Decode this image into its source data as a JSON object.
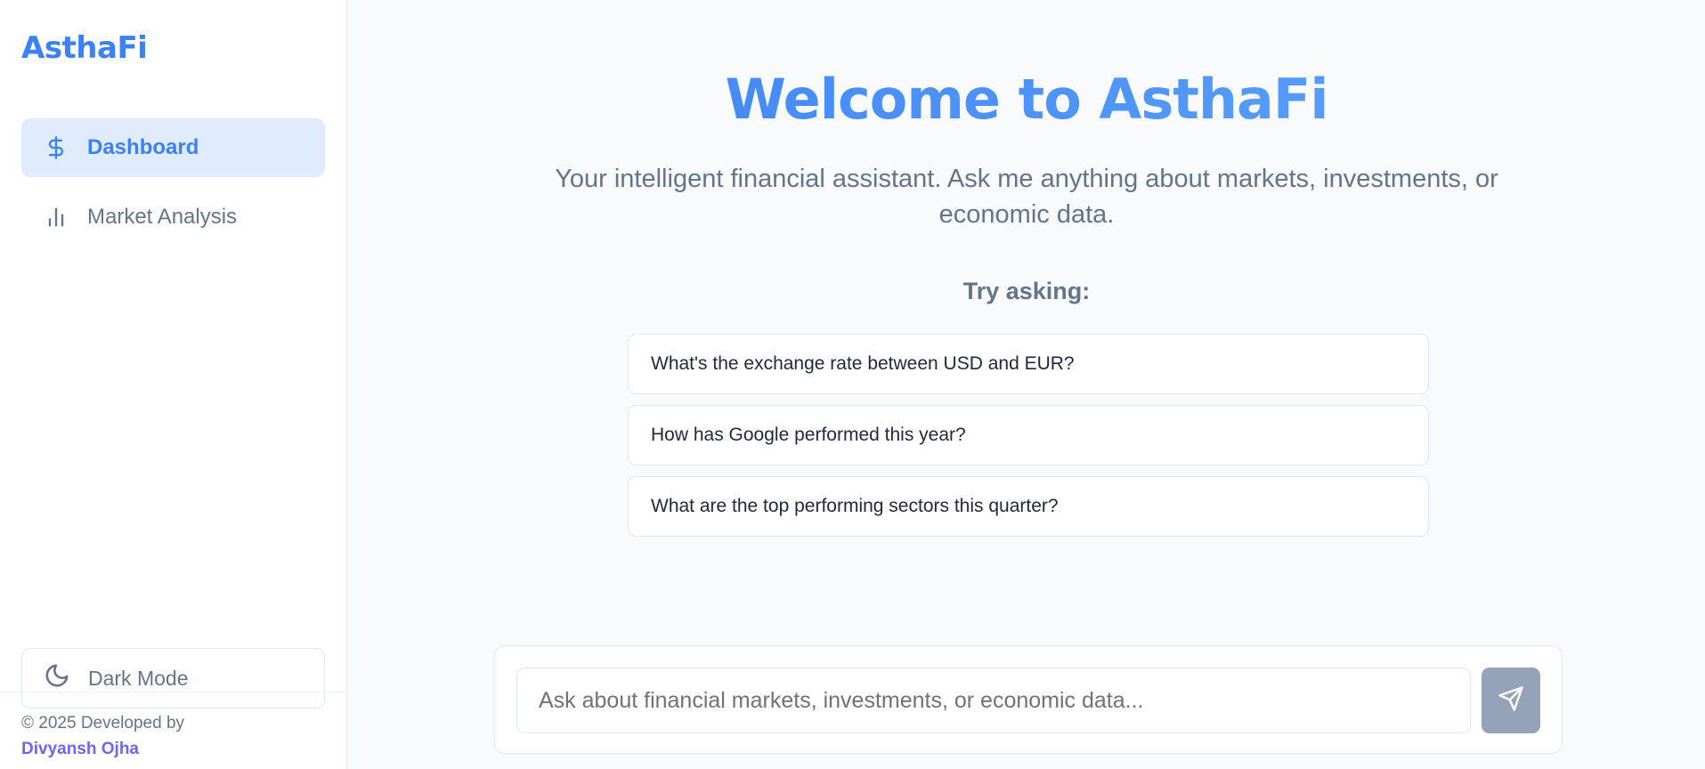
{
  "sidebar": {
    "brand": "AsthaFi",
    "items": [
      {
        "label": "Dashboard",
        "icon": "dollar-icon",
        "active": true
      },
      {
        "label": "Market Analysis",
        "icon": "bar-chart-icon",
        "active": false
      }
    ],
    "dark_mode_label": "Dark Mode",
    "footer": {
      "copyright": "© 2025",
      "developed_by": "Developed by",
      "author": "Divyansh Ojha"
    }
  },
  "main": {
    "welcome": "Welcome to AsthaFi",
    "subtitle": "Your intelligent financial assistant. Ask me anything about markets, investments, or economic data.",
    "try_asking": "Try asking:",
    "suggestions": [
      "What's the exchange rate between USD and EUR?",
      "How has Google performed this year?",
      "What are the top performing sectors this quarter?"
    ],
    "input": {
      "placeholder": "Ask about financial markets, investments, or economic data...",
      "value": ""
    }
  },
  "colors": {
    "accent": "#3b82f6",
    "author": "#6d66f0",
    "send_button": "#94a3b8",
    "active_nav_bg": "#e0ebfd"
  }
}
